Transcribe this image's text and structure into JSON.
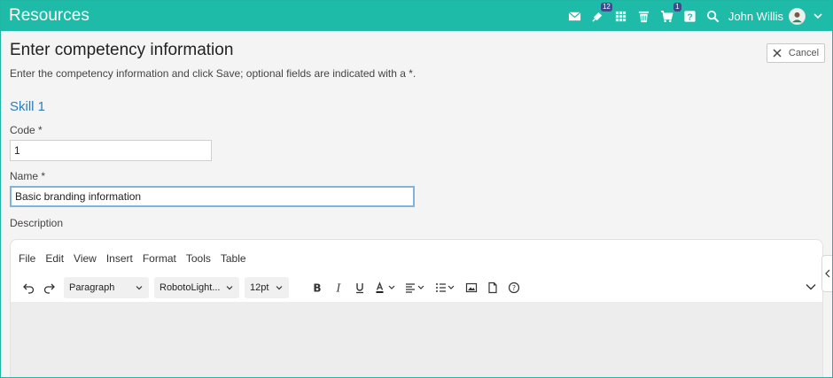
{
  "header": {
    "title": "Resources",
    "notifications_count": "12",
    "cart_count": "1",
    "user_name": "John Willis"
  },
  "page": {
    "title": "Enter competency information",
    "cancel_label": "Cancel",
    "instructions": "Enter the competency information and click Save; optional fields are indicated with a *.",
    "section_title": "Skill 1"
  },
  "form": {
    "code_label": "Code *",
    "code_value": "1",
    "name_label": "Name *",
    "name_value": "Basic branding information",
    "description_label": "Description"
  },
  "editor": {
    "menu": [
      "File",
      "Edit",
      "View",
      "Insert",
      "Format",
      "Tools",
      "Table"
    ],
    "block_format": "Paragraph",
    "font_family": "RobotoLight...",
    "font_size": "12pt"
  },
  "colors": {
    "header_bg": "#1dbba8",
    "section_title": "#2b7fb8",
    "focus_border": "#7fb4de"
  }
}
